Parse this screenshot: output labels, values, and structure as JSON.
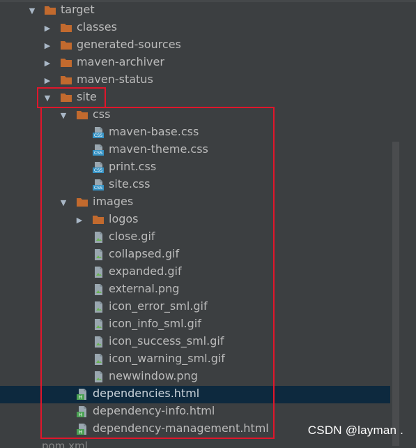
{
  "tree": {
    "rows": [
      {
        "label": "target",
        "type": "folder",
        "expanded": true,
        "level": 0
      },
      {
        "label": "classes",
        "type": "folder",
        "expanded": false,
        "level": 1
      },
      {
        "label": "generated-sources",
        "type": "folder",
        "expanded": false,
        "level": 1
      },
      {
        "label": "maven-archiver",
        "type": "folder",
        "expanded": false,
        "level": 1
      },
      {
        "label": "maven-status",
        "type": "folder",
        "expanded": false,
        "level": 1
      },
      {
        "label": "site",
        "type": "folder",
        "expanded": true,
        "level": 1
      },
      {
        "label": "css",
        "type": "folder",
        "expanded": true,
        "level": 2
      },
      {
        "label": "maven-base.css",
        "type": "css-file",
        "level": 3
      },
      {
        "label": "maven-theme.css",
        "type": "css-file",
        "level": 3
      },
      {
        "label": "print.css",
        "type": "css-file",
        "level": 3
      },
      {
        "label": "site.css",
        "type": "css-file",
        "level": 3
      },
      {
        "label": "images",
        "type": "folder",
        "expanded": true,
        "level": 2
      },
      {
        "label": "logos",
        "type": "folder",
        "expanded": false,
        "level": 3
      },
      {
        "label": "close.gif",
        "type": "image-file",
        "level": 3
      },
      {
        "label": "collapsed.gif",
        "type": "image-file",
        "level": 3
      },
      {
        "label": "expanded.gif",
        "type": "image-file",
        "level": 3
      },
      {
        "label": "external.png",
        "type": "image-file",
        "level": 3
      },
      {
        "label": "icon_error_sml.gif",
        "type": "image-file",
        "level": 3
      },
      {
        "label": "icon_info_sml.gif",
        "type": "image-file",
        "level": 3
      },
      {
        "label": "icon_success_sml.gif",
        "type": "image-file",
        "level": 3
      },
      {
        "label": "icon_warning_sml.gif",
        "type": "image-file",
        "level": 3
      },
      {
        "label": "newwindow.png",
        "type": "image-file",
        "level": 3
      },
      {
        "label": "dependencies.html",
        "type": "html-file",
        "level": 2,
        "selected": true
      },
      {
        "label": "dependency-info.html",
        "type": "html-file",
        "level": 2
      },
      {
        "label": "dependency-management.html",
        "type": "html-file",
        "level": 2
      }
    ],
    "cut_row_label": "pom.xml"
  },
  "colors": {
    "background": "#3c3f41",
    "folder": "#c26a2e",
    "selection": "#0d293e",
    "highlight_box": "#e0162b",
    "text": "#bbbbbb"
  },
  "watermark": "CSDN @layman ."
}
